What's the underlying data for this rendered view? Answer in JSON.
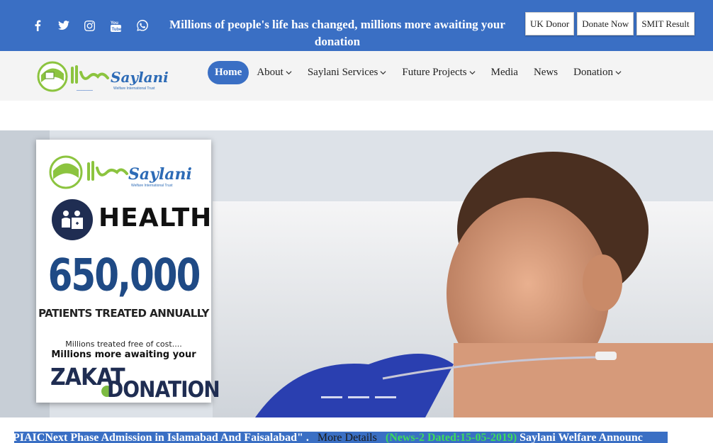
{
  "topbar": {
    "social_icons": [
      "facebook-icon",
      "twitter-icon",
      "instagram-icon",
      "youtube-icon",
      "whatsapp-icon"
    ],
    "tagline": "Millions of people's life has changed, millions more awaiting your donation",
    "buttons": [
      "UK Donor",
      "Donate Now",
      "SMIT Result"
    ],
    "bg_color": "#3a6fc4"
  },
  "nav": {
    "logo_text": "Saylani",
    "items": [
      {
        "label": "Home",
        "active": true,
        "dropdown": false
      },
      {
        "label": "About",
        "active": false,
        "dropdown": true
      },
      {
        "label": "Saylani Services",
        "active": false,
        "dropdown": true
      },
      {
        "label": "Future Projects",
        "active": false,
        "dropdown": true
      },
      {
        "label": "Media",
        "active": false,
        "dropdown": false
      },
      {
        "label": "News",
        "active": false,
        "dropdown": false
      },
      {
        "label": "Donation",
        "active": false,
        "dropdown": true
      }
    ]
  },
  "hero": {
    "card": {
      "logo_text": "Saylani",
      "logo_subtext": "Welfare International Trust",
      "category": "HEALTH",
      "stat_value": "650,000",
      "stat_label": "PATIENTS TREATED ANNUALLY",
      "line1": "Millions treated free of cost....",
      "line2": "Millions more awaiting your",
      "cta1": "ZAKAT",
      "cta2": "DONATION"
    },
    "slide_count": 3,
    "active_slide": 1
  },
  "ticker": {
    "segment1": "PIAICNext Phase Admission in Islamabad And Faisalabad\" .",
    "segment2": "More Details",
    "segment3": "(News-2 Dated:15-05-2019)",
    "segment4": "Saylani Welfare Announc"
  }
}
